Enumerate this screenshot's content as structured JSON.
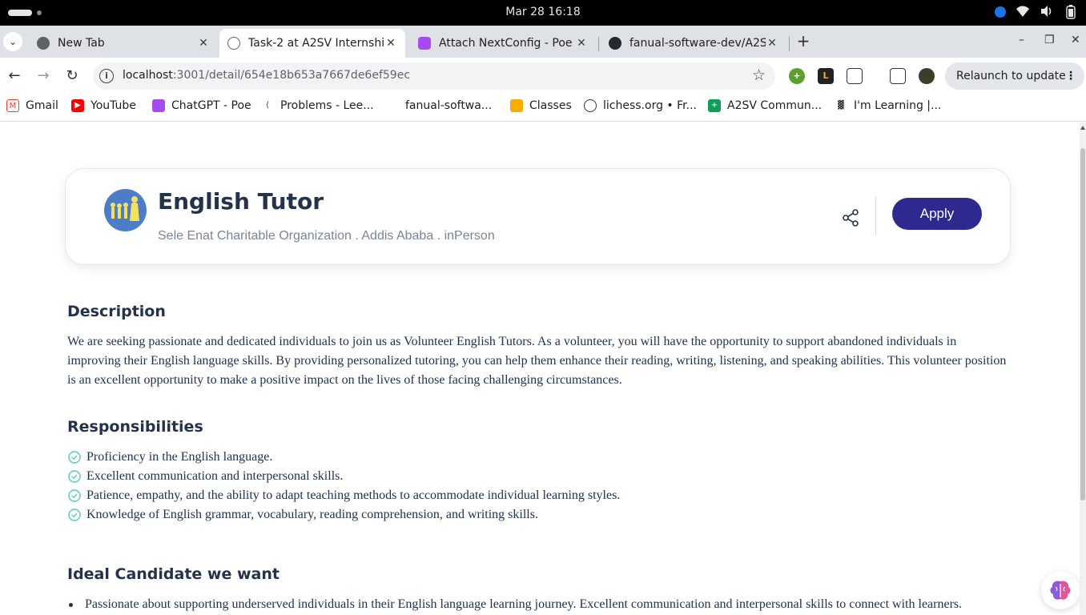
{
  "os": {
    "clock": "Mar 28  16:18"
  },
  "tabs": [
    {
      "label": "New Tab",
      "active": false
    },
    {
      "label": "Task-2 at A2SV Internship",
      "active": true
    },
    {
      "label": "Attach NextConfig - Poe",
      "active": false
    },
    {
      "label": "fanual-software-dev/A2SV",
      "active": false
    }
  ],
  "address_bar": {
    "host": "localhost",
    "path": ":3001/detail/654e18b653a7667de6ef59ec"
  },
  "toolbar": {
    "relaunch_label": "Relaunch to update"
  },
  "bookmarks": [
    {
      "label": "Gmail",
      "icon": "gmail-icon"
    },
    {
      "label": "YouTube",
      "icon": "youtube-icon"
    },
    {
      "label": "ChatGPT - Poe",
      "icon": "poe-icon"
    },
    {
      "label": "Problems - Lee...",
      "icon": "leetcode-icon"
    },
    {
      "label": "fanual-softwa...",
      "icon": "github-icon"
    },
    {
      "label": "Classes",
      "icon": "classroom-icon"
    },
    {
      "label": "lichess.org • Fr...",
      "icon": "lichess-icon"
    },
    {
      "label": "A2SV Commun...",
      "icon": "sheets-icon"
    },
    {
      "label": "I'm Learning |...",
      "icon": "learning-icon"
    }
  ],
  "job": {
    "title": "English Tutor",
    "subtitle": "Sele Enat Charitable Organization . Addis Ababa . inPerson",
    "apply_label": "Apply",
    "accent_color": "#2d298e"
  },
  "description": {
    "heading": "Description",
    "text": "We are seeking passionate and dedicated individuals to join us as Volunteer English Tutors. As a volunteer, you will have the opportunity to support abandoned individuals in improving their English language skills. By providing personalized tutoring, you can help them enhance their reading, writing, listening, and speaking abilities. This volunteer position is an excellent opportunity to make a positive impact on the lives of those facing challenging circumstances."
  },
  "responsibilities": {
    "heading": "Responsibilities",
    "items": [
      "Proficiency in the English language.",
      "Excellent communication and interpersonal skills.",
      "Patience, empathy, and the ability to adapt teaching methods to accommodate individual learning styles.",
      "Knowledge of English grammar, vocabulary, reading comprehension, and writing skills."
    ]
  },
  "ideal": {
    "heading": "Ideal Candidate we want",
    "items": [
      "Passionate about supporting underserved individuals in their English language learning journey. Excellent communication and interpersonal skills to connect with learners."
    ]
  }
}
